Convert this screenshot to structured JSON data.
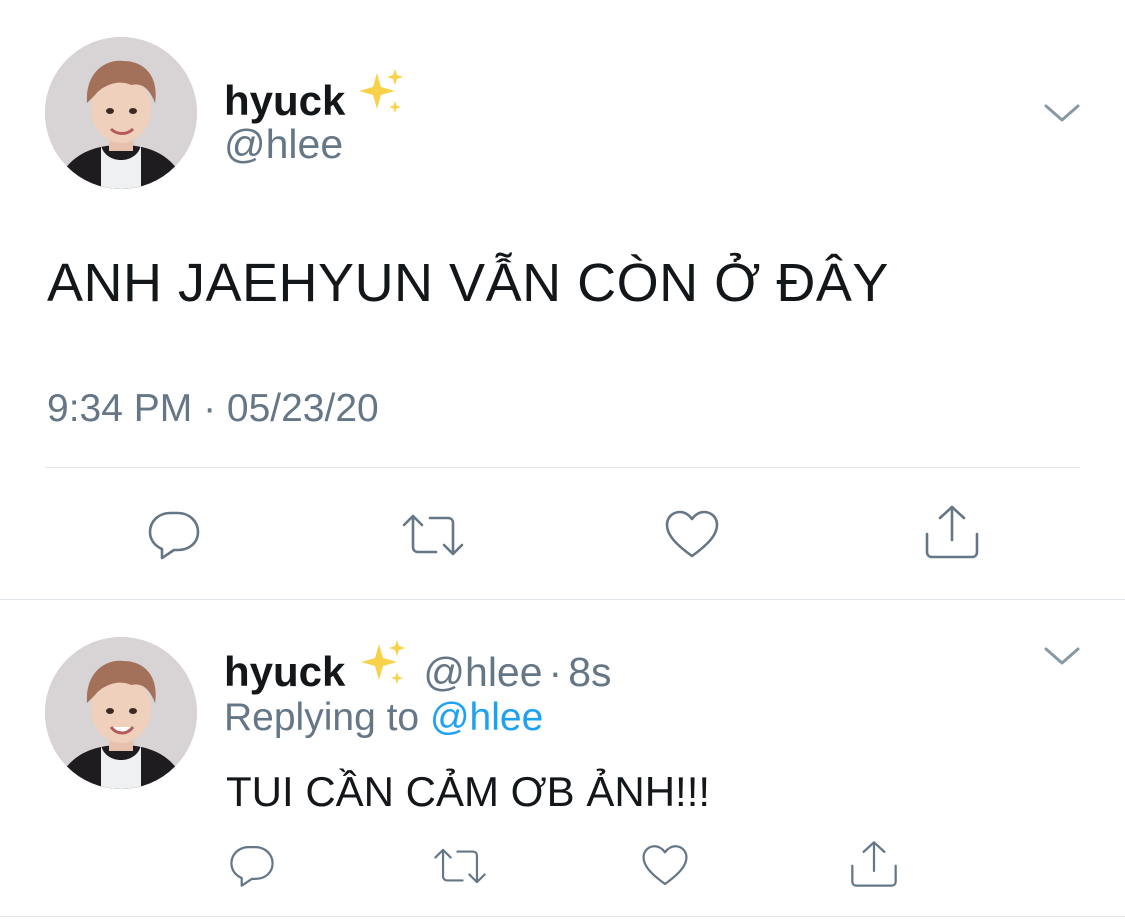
{
  "tweet": {
    "author": {
      "name": "hyuck",
      "handle": "@hlee",
      "badge_icon": "sparkles-icon"
    },
    "text": "ANH JAEHYUN VẪN CÒN Ở ĐÂY",
    "timestamp": "9:34 PM · 05/23/20",
    "actions": [
      {
        "name": "reply",
        "icon": "reply-icon"
      },
      {
        "name": "retweet",
        "icon": "retweet-icon"
      },
      {
        "name": "like",
        "icon": "heart-icon"
      },
      {
        "name": "share",
        "icon": "share-icon"
      }
    ]
  },
  "reply": {
    "author": {
      "name": "hyuck",
      "handle": "@hlee",
      "badge_icon": "sparkles-icon"
    },
    "separator": "·",
    "time": "8s",
    "replying_prefix": "Replying to",
    "replying_to": "@hlee",
    "text": "TUI CẦN CẢM ƠB ẢNH!!!"
  },
  "colors": {
    "text_primary": "#14171a",
    "text_secondary": "#657786",
    "link": "#1da1f2",
    "divider": "#e1e8ed"
  }
}
